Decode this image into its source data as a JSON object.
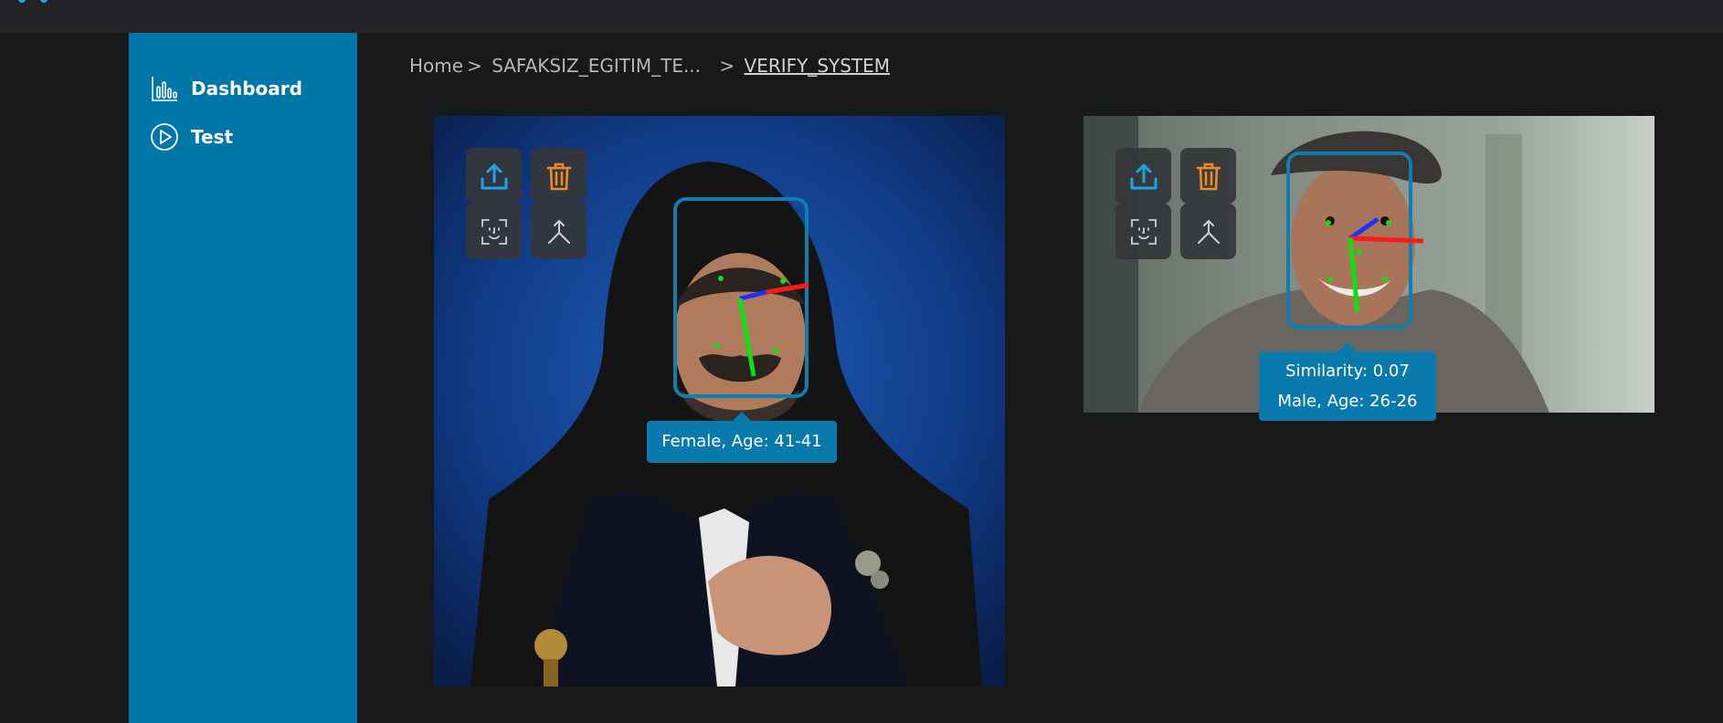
{
  "sidebar": {
    "items": [
      {
        "label": "Dashboard",
        "icon": "bar-chart-icon"
      },
      {
        "label": "Test",
        "icon": "play-circle-icon"
      }
    ]
  },
  "breadcrumb": {
    "home": "Home",
    "project": "SAFAKSIZ_EGITIM_TE...",
    "current": "VERIFY_SYSTEM",
    "separator": ">"
  },
  "left_image": {
    "face_label": "Female, Age: 41-41",
    "tools": [
      "upload-icon",
      "trash-icon",
      "face-scan-icon",
      "merge-icon"
    ]
  },
  "right_image": {
    "similarity": "Similarity: 0.07",
    "face_label": "Male, Age: 26-26",
    "tools": [
      "upload-icon",
      "trash-icon",
      "face-scan-icon",
      "merge-icon"
    ]
  },
  "colors": {
    "sidebar": "#0077a8",
    "background": "#18191b",
    "upload_icon": "#1aa7e8",
    "trash_icon": "#f08a24",
    "face_box": "#0e7fb0",
    "pose_x": "#ff1a1a",
    "pose_y": "#10e010",
    "pose_z": "#2030ff"
  }
}
